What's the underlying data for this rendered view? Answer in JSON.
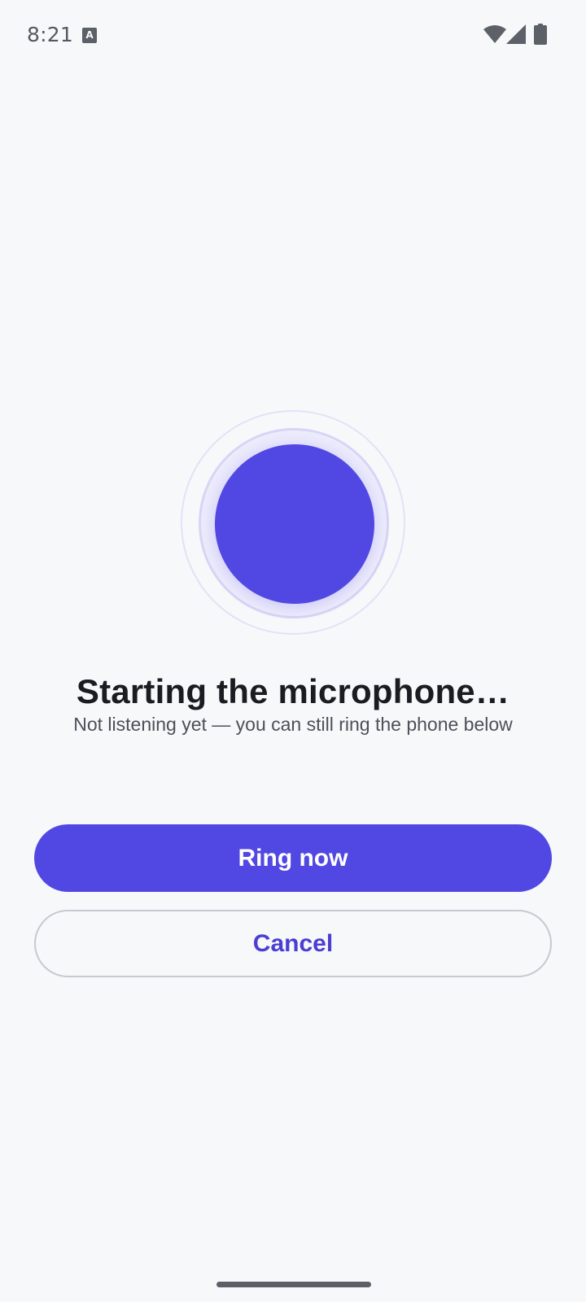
{
  "status_bar": {
    "time": "8:21",
    "notification_icon_glyph": "A",
    "icons": [
      "notification-icon",
      "wifi-icon",
      "signal-icon",
      "battery-icon"
    ]
  },
  "mic": {
    "icon": "microphone-orb",
    "accent_color": "#5148e4"
  },
  "main": {
    "title": "Starting the microphone…",
    "subtitle": "Not listening yet — you can still ring the phone below"
  },
  "actions": {
    "ring_now_label": "Ring now",
    "cancel_label": "Cancel"
  },
  "colors": {
    "primary": "#5148e4",
    "background": "#f7f8fa",
    "text_primary": "#1b1c21",
    "text_secondary": "#4c5058"
  }
}
